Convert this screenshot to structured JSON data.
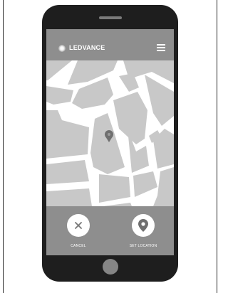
{
  "app": {
    "brand": "LEDVANCE"
  },
  "header": {
    "logo_icon": "ledvance-glow-logo-icon",
    "menu_icon": "hamburger-menu-icon"
  },
  "map": {
    "pin_icon": "map-pin-icon"
  },
  "actions": {
    "cancel": {
      "label": "CANCEL",
      "icon": "close-x-icon"
    },
    "set_location": {
      "label": "SET LOCATION",
      "icon": "location-pin-icon"
    }
  },
  "colors": {
    "phone_body": "#1e1e1e",
    "chrome_gray": "#8e8e8e",
    "map_block": "#c8c8c8",
    "map_road": "#ffffff",
    "dark_icon": "#6f6f6f"
  }
}
